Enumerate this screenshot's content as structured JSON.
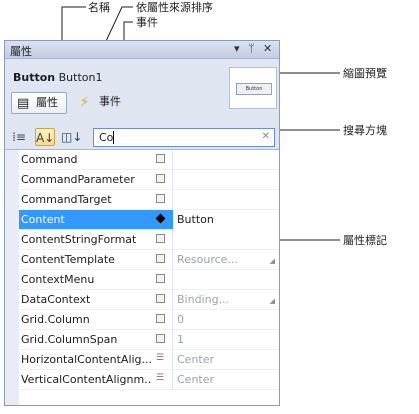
{
  "callouts": {
    "name": "名稱",
    "sort_by_source": "依屬性來源排序",
    "events": "事件",
    "thumbnail": "縮圖預覽",
    "search_box": "搜尋方塊",
    "property_marker": "屬性標記"
  },
  "panel": {
    "title": "屬性",
    "title_icons": [
      "pin-dropdown-icon",
      "pin-icon",
      "close-icon"
    ],
    "object_type": "Button",
    "object_name": "Button1",
    "tabs": {
      "properties": "屬性",
      "events": "事件"
    },
    "thumbnail_label": "Button",
    "search_value": "Co",
    "properties": [
      {
        "name": "Command",
        "value": "",
        "marker": "default"
      },
      {
        "name": "CommandParameter",
        "value": "",
        "marker": "default"
      },
      {
        "name": "CommandTarget",
        "value": "",
        "marker": "default"
      },
      {
        "name": "Content",
        "value": "Button",
        "marker": "local",
        "selected": true
      },
      {
        "name": "ContentStringFormat",
        "value": "",
        "marker": "default"
      },
      {
        "name": "ContentTemplate",
        "value": "Resource...",
        "marker": "default",
        "dropdown": true
      },
      {
        "name": "ContextMenu",
        "value": "",
        "marker": "default"
      },
      {
        "name": "DataContext",
        "value": "Binding...",
        "marker": "default",
        "dropdown": true
      },
      {
        "name": "Grid.Column",
        "value": "0",
        "marker": "default"
      },
      {
        "name": "Grid.ColumnSpan",
        "value": "1",
        "marker": "default"
      },
      {
        "name": "HorizontalContentAlig...",
        "value": "Center",
        "marker": "resource"
      },
      {
        "name": "VerticalContentAlignm...",
        "value": "Center",
        "marker": "resource"
      }
    ]
  }
}
